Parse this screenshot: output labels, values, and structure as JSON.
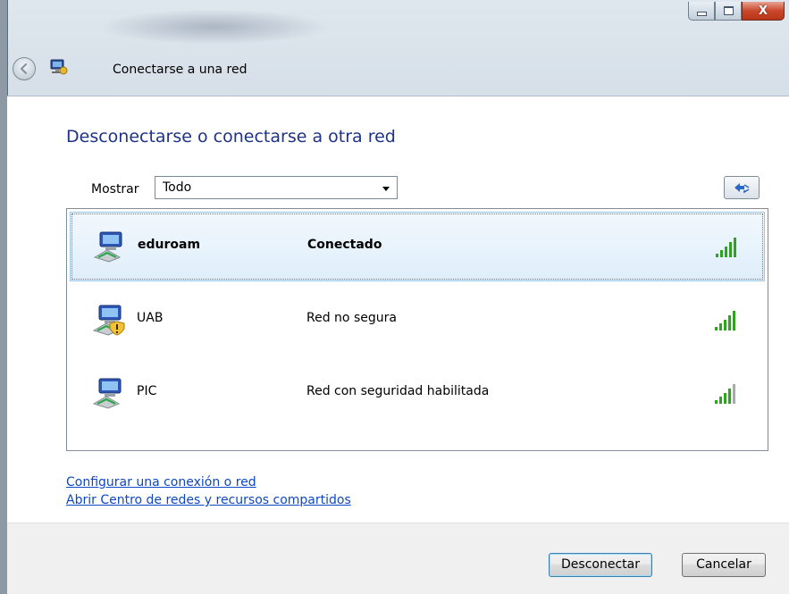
{
  "window": {
    "title": "Conectarse a una red",
    "close_glyph": "X"
  },
  "main": {
    "heading": "Desconectarse o conectarse a otra red",
    "show_label": "Mostrar",
    "show_value": "Todo"
  },
  "networks": [
    {
      "name": "eduroam",
      "status": "Conectado",
      "selected": true,
      "signal_bars": 5,
      "secure": true
    },
    {
      "name": "UAB",
      "status": "Red no segura",
      "selected": false,
      "signal_bars": 5,
      "secure": false
    },
    {
      "name": "PIC",
      "status": "Red con seguridad habilitada",
      "selected": false,
      "signal_bars": 4,
      "secure": true
    }
  ],
  "links": {
    "setup": "Configurar una conexión o red",
    "center": "Abrir Centro de redes y recursos compartidos"
  },
  "buttons": {
    "disconnect": "Desconectar",
    "cancel": "Cancelar"
  },
  "colors": {
    "heading": "#1e3287",
    "link": "#0e47c2",
    "signal_on": "#2ea31f",
    "signal_off": "#a9a9a9"
  }
}
